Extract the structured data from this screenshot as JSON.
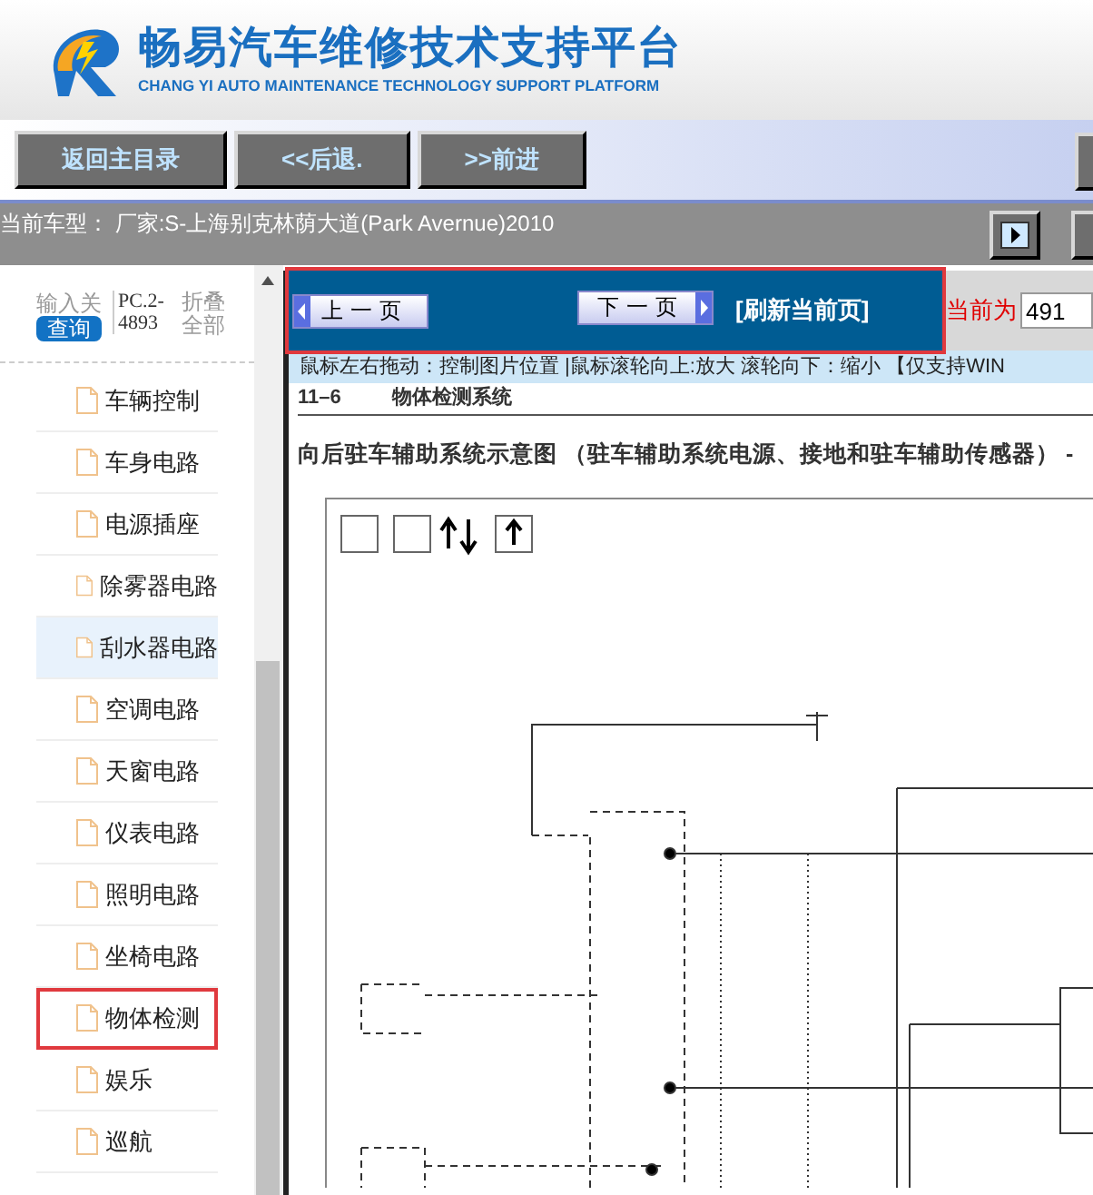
{
  "header": {
    "title": "畅易汽车维修技术支持平台",
    "subtitle": "CHANG YI AUTO MAINTENANCE TECHNOLOGY SUPPORT PLATFORM"
  },
  "toolbar": {
    "buttons": [
      "返回主目录",
      "<<后退.",
      ">>前进"
    ]
  },
  "vehicle_bar": {
    "text": "当前车型：  厂家:S-上海别克林荫大道(Park Avernue)2010"
  },
  "sidebar": {
    "search_label": "输入关",
    "search_button": "查询",
    "code": "PC.2-4893",
    "collapse": "折叠全部",
    "items": [
      {
        "label": "车辆控制",
        "selected": false,
        "marked": false
      },
      {
        "label": "车身电路",
        "selected": false,
        "marked": false
      },
      {
        "label": "电源插座",
        "selected": false,
        "marked": false
      },
      {
        "label": "除雾器电路",
        "selected": false,
        "marked": false
      },
      {
        "label": "刮水器电路",
        "selected": true,
        "marked": false
      },
      {
        "label": "空调电路",
        "selected": false,
        "marked": false
      },
      {
        "label": "天窗电路",
        "selected": false,
        "marked": false
      },
      {
        "label": "仪表电路",
        "selected": false,
        "marked": false
      },
      {
        "label": "照明电路",
        "selected": false,
        "marked": false
      },
      {
        "label": "坐椅电路",
        "selected": false,
        "marked": false
      },
      {
        "label": "物体检测",
        "selected": false,
        "marked": true
      },
      {
        "label": "娱乐",
        "selected": false,
        "marked": false
      },
      {
        "label": "巡航",
        "selected": false,
        "marked": false
      }
    ]
  },
  "pager": {
    "marked": true,
    "prev": "上一页",
    "next": "下一页",
    "refresh": "[刷新当前页]",
    "current_label": "当前为",
    "page_value": "491"
  },
  "hint": "鼠标左右拖动：控制图片位置 |鼠标滚轮向上:放大  滚轮向下：缩小 【仅支持WIN",
  "document": {
    "section_number": "11–6",
    "section_title": "物体检测系统",
    "diagram_title": "向后驻车辅助系统示意图 （驻车辅助系统电源、接地和驻车辅助传感器） -"
  }
}
